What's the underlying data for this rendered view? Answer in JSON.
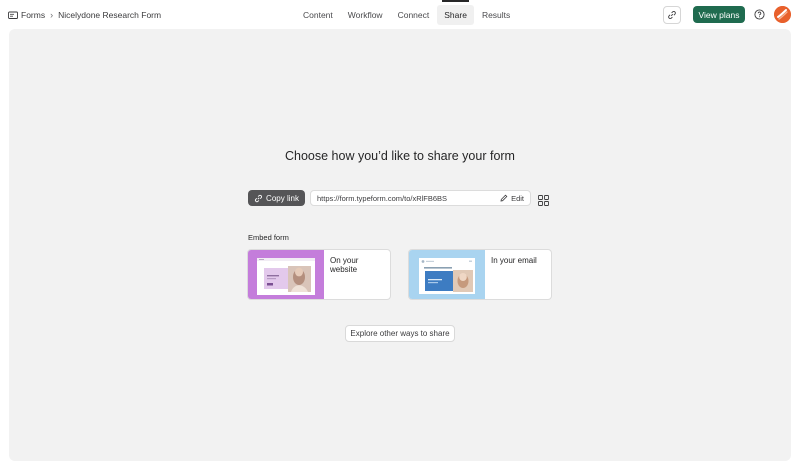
{
  "breadcrumb": {
    "root_label": "Forms",
    "separator": "›",
    "current_label": "Nicelydone Research Form"
  },
  "tabs": [
    {
      "label": "Content",
      "active": false
    },
    {
      "label": "Workflow",
      "active": false
    },
    {
      "label": "Connect",
      "active": false
    },
    {
      "label": "Share",
      "active": true
    },
    {
      "label": "Results",
      "active": false
    }
  ],
  "header": {
    "link_icon": "link-icon",
    "view_plans_label": "View plans",
    "help_icon": "help-circle-icon",
    "avatar_icon": "user-avatar"
  },
  "share": {
    "headline": "Choose how you’d like to share your form",
    "copy_link_label": "Copy link",
    "url": "https://form.typeform.com/to/xRlFB6BS",
    "edit_label": "Edit",
    "qr_icon": "qr-code-icon"
  },
  "embed": {
    "label": "Embed form",
    "options": [
      {
        "label": "On your website",
        "thumb_color": "#c47ddb"
      },
      {
        "label": "In your email",
        "thumb_color": "#a9d4f0"
      }
    ]
  },
  "explore_label": "Explore other ways to share",
  "colors": {
    "accent": "#1f6b4f",
    "canvas": "#f2f2f2",
    "copy_button": "#555557",
    "avatar": "#e8602c"
  }
}
